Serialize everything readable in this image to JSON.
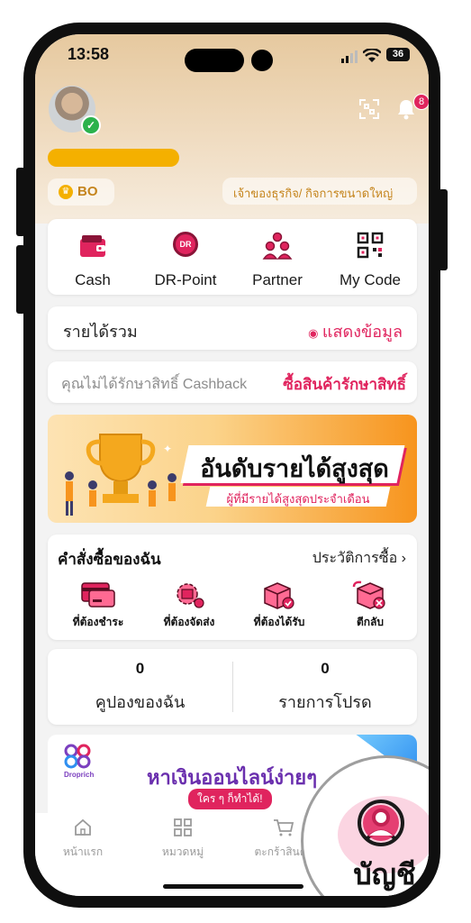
{
  "status_bar": {
    "time": "13:58",
    "battery": "36"
  },
  "header": {
    "notification_count": "8",
    "membership_badge": "BO",
    "business_type": "เจ้าของธุรกิจ/ กิจการขนาดใหญ่"
  },
  "quick_actions": [
    {
      "label": "Cash",
      "icon": "wallet-icon"
    },
    {
      "label": "DR-Point",
      "icon": "dr-point-icon",
      "icon_text": "DR"
    },
    {
      "label": "Partner",
      "icon": "partner-icon"
    },
    {
      "label": "My Code",
      "icon": "qr-code-icon"
    }
  ],
  "income": {
    "label": "รายได้รวม",
    "show_label": "แสดงข้อมูล"
  },
  "cashback": {
    "message": "คุณไม่ได้รักษาสิทธิ์ Cashback",
    "action": "ซื้อสินค้ารักษาสิทธิ์"
  },
  "banner": {
    "title": "อันดับรายได้สูงสุด",
    "subtitle": "ผู้ที่มีรายได้สูงสุดประจำเดือน"
  },
  "orders": {
    "title": "คำสั่งซื้อของฉัน",
    "history_link": "ประวัติการซื้อ",
    "items": [
      {
        "label": "ที่ต้องชำระ",
        "icon": "payment-card-icon"
      },
      {
        "label": "ที่ต้องจัดส่ง",
        "icon": "shipping-icon"
      },
      {
        "label": "ที่ต้องได้รับ",
        "icon": "box-received-icon"
      },
      {
        "label": "ตีกลับ",
        "icon": "return-box-icon"
      }
    ]
  },
  "stats": [
    {
      "value": "0",
      "label": "คูปองของฉัน"
    },
    {
      "value": "0",
      "label": "รายการโปรด"
    }
  ],
  "promo": {
    "logo_text": "Droprich",
    "title": "หาเงินออนไลน์ง่ายๆ",
    "tag": "ใคร ๆ ก็ทำได้!"
  },
  "bottom_nav": [
    {
      "label": "หน้าแรก",
      "icon": "home-icon"
    },
    {
      "label": "หมวดหมู่",
      "icon": "grid-icon"
    },
    {
      "label": "ตะกร้าสินค้า",
      "icon": "cart-icon"
    },
    {
      "label": "บัญชี",
      "icon": "account-icon"
    }
  ],
  "colors": {
    "accent": "#e0245e",
    "gold": "#f4b000",
    "brand_orange": "#f7941d"
  }
}
